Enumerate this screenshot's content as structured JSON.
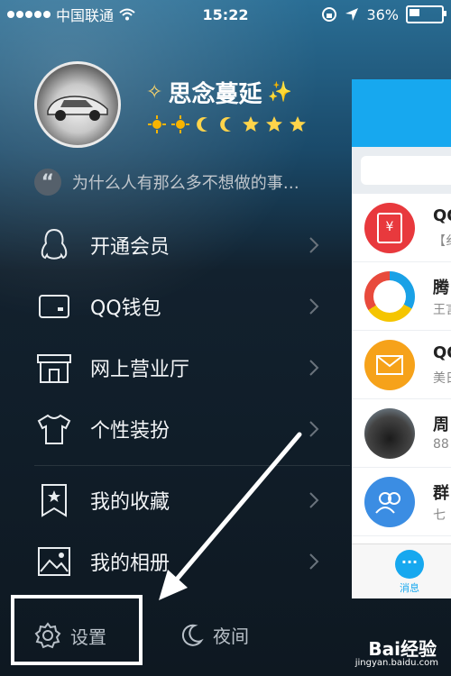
{
  "status_bar": {
    "carrier": "中国联通",
    "time": "15:22",
    "battery": "36%",
    "battery_level": 0.36
  },
  "profile": {
    "name": "思念蔓延",
    "level_icons": [
      "sun-icon",
      "sun-icon",
      "moon-icon",
      "moon-icon",
      "star-icon",
      "star-icon",
      "star-icon"
    ]
  },
  "signature": {
    "text": "为什么人有那么多不想做的事…"
  },
  "menu": {
    "items": [
      {
        "icon": "penguin-icon",
        "label": "开通会员"
      },
      {
        "icon": "wallet-icon",
        "label": "QQ钱包"
      },
      {
        "icon": "shop-icon",
        "label": "网上营业厅"
      },
      {
        "icon": "shirt-icon",
        "label": "个性装扮"
      },
      {
        "icon": "bookmark-star-icon",
        "label": "我的收藏"
      },
      {
        "icon": "photo-icon",
        "label": "我的相册"
      }
    ]
  },
  "bottom": {
    "settings_label": "设置",
    "night_label": "夜间"
  },
  "right_panel": {
    "conversations": [
      {
        "icon": "red-envelope-icon",
        "title": "QQ",
        "sub": "【纟"
      },
      {
        "icon": "tencent-news-icon",
        "title": "腾",
        "sub": "王言"
      },
      {
        "icon": "mail-icon",
        "title": "QQ",
        "sub": "美日"
      },
      {
        "icon": "car-avatar",
        "title": "周",
        "sub": "88"
      },
      {
        "icon": "group-icon",
        "title": "群",
        "sub": "七"
      }
    ],
    "tab_label": "消息"
  },
  "watermark": {
    "brand": "Bai经验",
    "url": "jingyan.baidu.com"
  },
  "colors": {
    "accent": "#17a8ef",
    "highlight_box": "#ffffff"
  }
}
